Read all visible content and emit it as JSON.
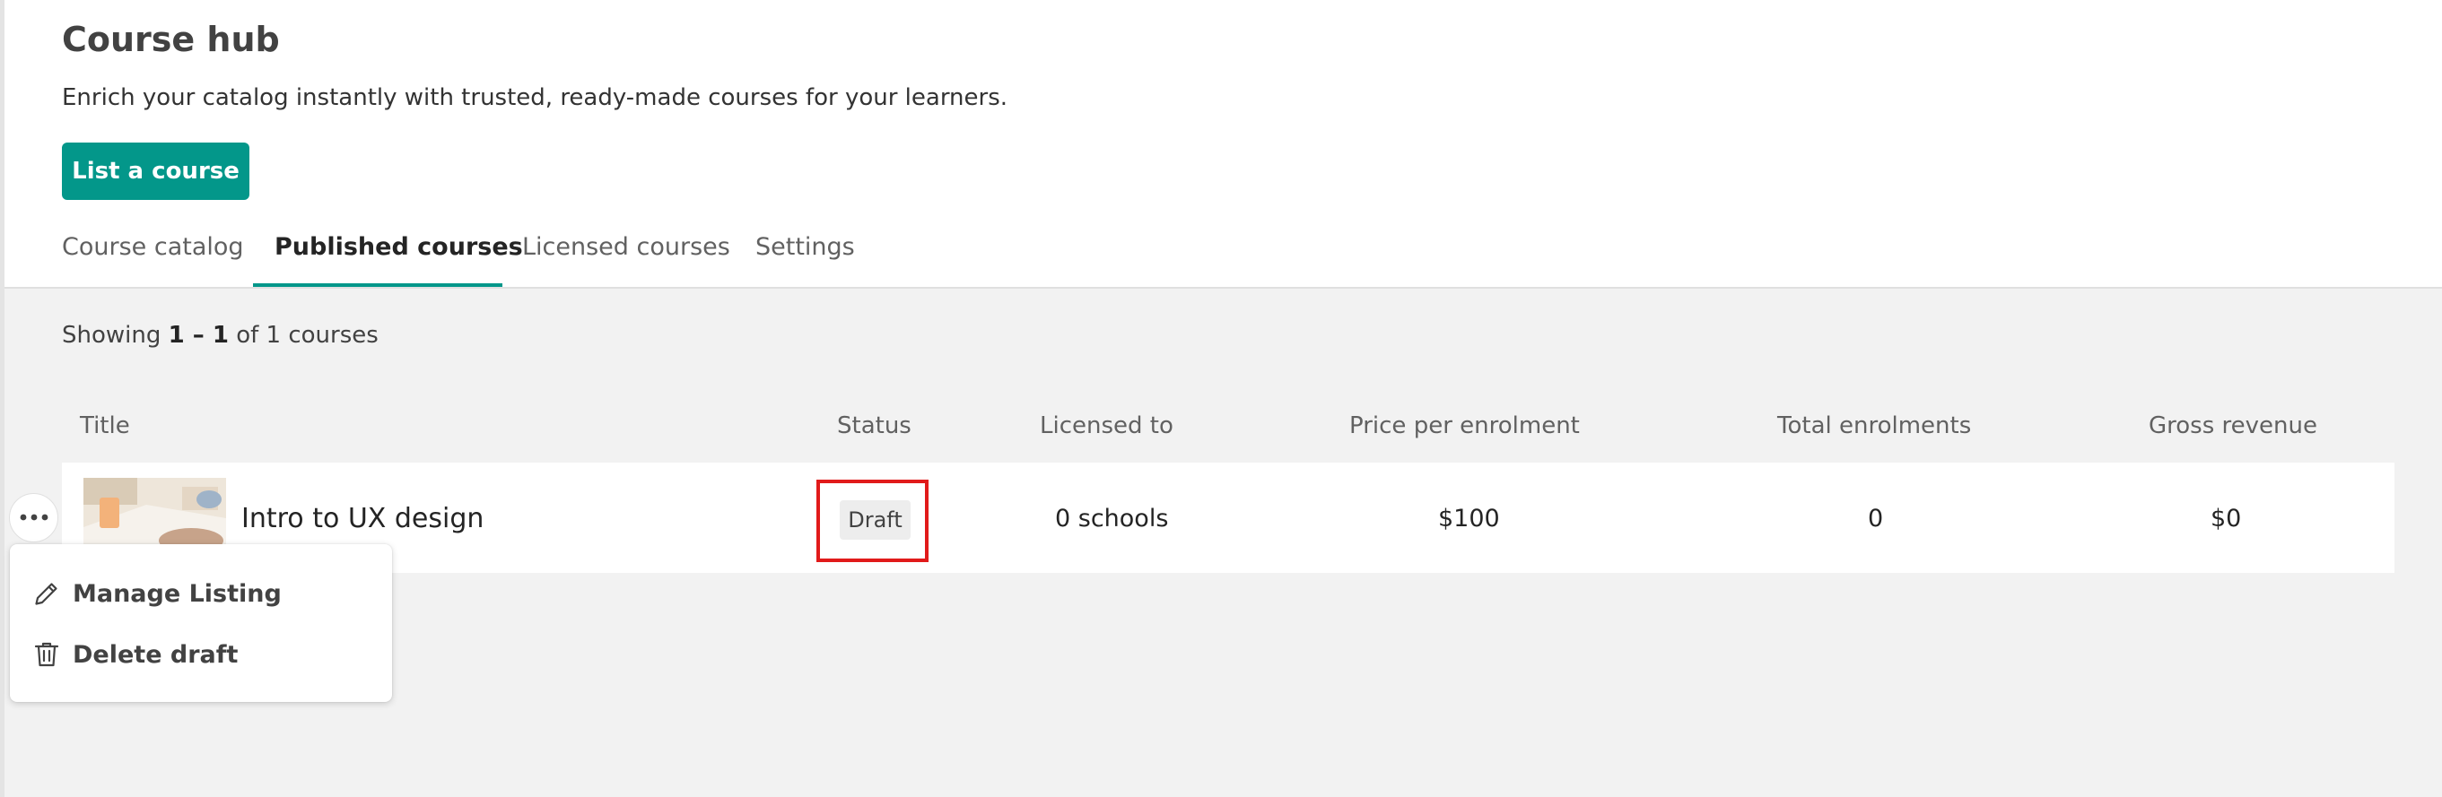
{
  "header": {
    "title": "Course hub",
    "subtitle": "Enrich your catalog instantly with trusted, ready-made courses for your learners.",
    "primary_action_label": "List a course"
  },
  "tabs": [
    {
      "label": "Course catalog",
      "active": false
    },
    {
      "label": "Published courses",
      "active": true
    },
    {
      "label": "Licensed courses",
      "active": false
    },
    {
      "label": "Settings",
      "active": false
    }
  ],
  "results": {
    "prefix": "Showing",
    "range": "1 – 1",
    "suffix": "of 1 courses"
  },
  "table": {
    "columns": [
      "Title",
      "Status",
      "Licensed to",
      "Price per enrolment",
      "Total enrolments",
      "Gross revenue"
    ],
    "rows": [
      {
        "title": "Intro to UX design",
        "status": "Draft",
        "licensed_to": "0 schools",
        "price_per_enrolment": "$100",
        "total_enrolments": "0",
        "gross_revenue": "$0"
      }
    ]
  },
  "row_menu": {
    "items": [
      {
        "label": "Manage Listing",
        "icon": "pencil-icon"
      },
      {
        "label": "Delete draft",
        "icon": "trash-icon"
      }
    ]
  },
  "colors": {
    "accent": "#03978a",
    "highlight": "#e11a1a",
    "panel": "#ffffff",
    "canvas": "#f2f2f2"
  }
}
